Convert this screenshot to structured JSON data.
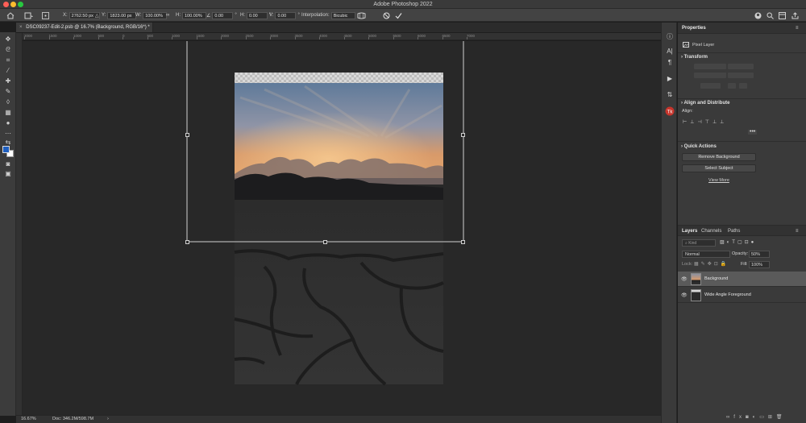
{
  "app": {
    "title": "Adobe Photoshop 2022"
  },
  "options": {
    "x_label": "X:",
    "x_value": "2762.50 px",
    "y_label": "Y:",
    "y_value": "1823.00 px",
    "w_label": "W:",
    "w_value": "100.00%",
    "h_label": "H:",
    "h_value": "100.00%",
    "angle_value": "0.00",
    "hskew_label": "H:",
    "hskew_value": "0.00",
    "vskew_label": "V:",
    "vskew_value": "0.00",
    "interp_label": "Interpolation:",
    "interp_value": "Bicubic"
  },
  "document": {
    "tab_label": "DSC09237-Edit-2.psb @ 16.7% (Background, RGB/16*) *"
  },
  "ruler_ticks": [
    "2000",
    "1500",
    "1000",
    "500",
    "0",
    "500",
    "1000",
    "1500",
    "2000",
    "2500",
    "3000",
    "3500",
    "4000",
    "4500",
    "5000",
    "5500",
    "6000",
    "6500",
    "7000"
  ],
  "status": {
    "zoom": "16.67%",
    "doc": "Doc: 346.2M/598.7M",
    "arrow": "›"
  },
  "properties": {
    "tab": "Properties",
    "layer_kind": "Pixel Layer",
    "transform_title": "Transform",
    "align_title": "Align and Distribute",
    "align_label": "Align:",
    "quick_actions_title": "Quick Actions",
    "remove_bg": "Remove Background",
    "select_subject": "Select Subject",
    "view_more": "View More"
  },
  "layers": {
    "tabs": [
      "Layers",
      "Channels",
      "Paths"
    ],
    "kind_placeholder": "Kind",
    "blend_mode": "Normal",
    "opacity_label": "Opacity:",
    "opacity_value": "50%",
    "lock_label": "Lock:",
    "fill_label": "Fill:",
    "fill_value": "100%",
    "items": [
      {
        "name": "Background",
        "selected": true
      },
      {
        "name": "Wide Angle Foreground",
        "selected": false
      }
    ]
  },
  "colors": {
    "accent": "#2f6fd6",
    "foreground_swatch": "#1f5fbf",
    "background_swatch": "#ffffff"
  }
}
